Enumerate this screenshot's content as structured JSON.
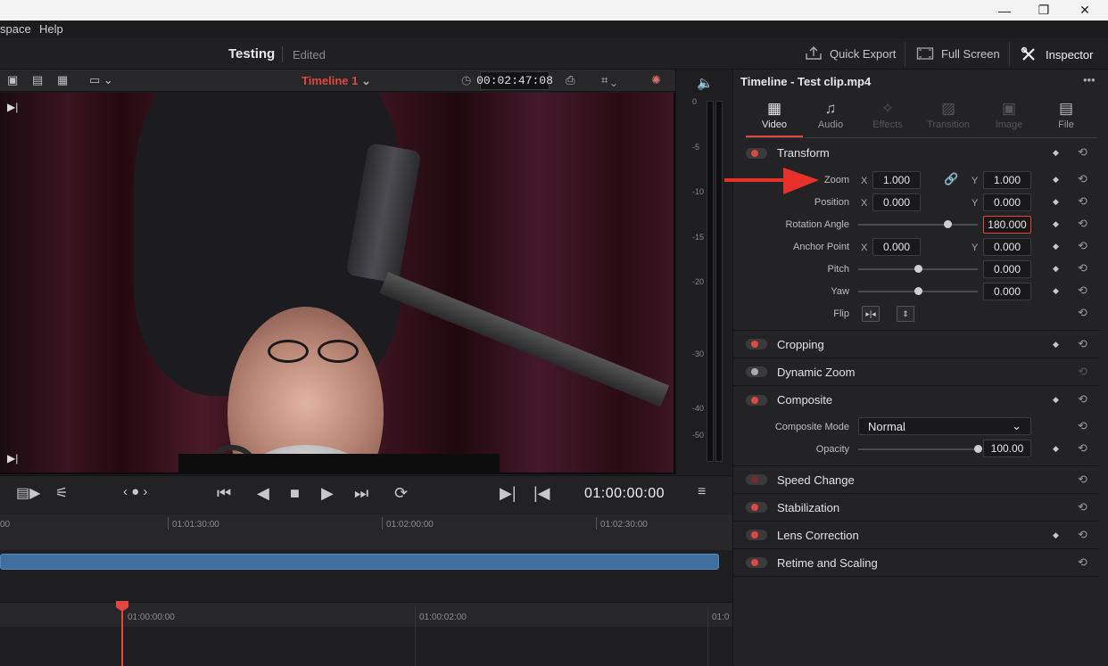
{
  "window": {
    "minimize": "—",
    "maximize": "❐",
    "close": "✕"
  },
  "menu": {
    "items": [
      "space",
      "Help"
    ]
  },
  "project": {
    "title": "Testing",
    "status": "Edited"
  },
  "header_buttons": {
    "quick_export": "Quick Export",
    "full_screen": "Full Screen",
    "inspector": "Inspector"
  },
  "viewer": {
    "timeline_name": "Timeline 1",
    "timecode": "00:02:47:08"
  },
  "meter": {
    "ticks": [
      "0",
      "-5",
      "-10",
      "-15",
      "-20",
      "-30",
      "-40",
      "-50"
    ]
  },
  "transport": {
    "timecode": "01:00:00:00"
  },
  "ruler": {
    "labels": [
      "00",
      "01:01:30:00",
      "01:02:00:00",
      "01:02:30:00"
    ]
  },
  "ruler2": {
    "labels": [
      "01:00:00:00",
      "01:00:02:00",
      "01:0"
    ]
  },
  "inspector": {
    "title": "Timeline - Test clip.mp4",
    "menu_icon": "•••",
    "tabs": [
      {
        "label": "Video",
        "icon": "film-icon",
        "glyph": "▦",
        "active": true
      },
      {
        "label": "Audio",
        "icon": "music-icon",
        "glyph": "♫",
        "active": false
      },
      {
        "label": "Effects",
        "icon": "magic-wand-icon",
        "glyph": "✧",
        "active": false
      },
      {
        "label": "Transition",
        "icon": "transition-icon",
        "glyph": "▨",
        "active": false
      },
      {
        "label": "Image",
        "icon": "image-icon",
        "glyph": "▣",
        "active": false
      },
      {
        "label": "File",
        "icon": "file-icon",
        "glyph": "▤",
        "active": false
      }
    ],
    "transform": {
      "header": "Transform",
      "zoom_label": "Zoom",
      "zoom_x": "1.000",
      "zoom_y": "1.000",
      "position_label": "Position",
      "position_x": "0.000",
      "position_y": "0.000",
      "rotation_label": "Rotation Angle",
      "rotation_value": "180.000",
      "rotation_level": 0.75,
      "anchor_label": "Anchor Point",
      "anchor_x": "0.000",
      "anchor_y": "0.000",
      "pitch_label": "Pitch",
      "pitch_value": "0.000",
      "pitch_level": 0.5,
      "yaw_label": "Yaw",
      "yaw_value": "0.000",
      "yaw_level": 0.5,
      "flip_label": "Flip",
      "x_axis": "X",
      "y_axis": "Y"
    },
    "sections": {
      "cropping": "Cropping",
      "dynamic_zoom": "Dynamic Zoom",
      "composite": "Composite",
      "composite_mode_label": "Composite Mode",
      "composite_mode_value": "Normal",
      "opacity_label": "Opacity",
      "opacity_value": "100.00",
      "opacity_level": 1.0,
      "speed_change": "Speed Change",
      "stabilization": "Stabilization",
      "lens_correction": "Lens Correction",
      "retime_scaling": "Retime and Scaling"
    }
  },
  "colors": {
    "accent": "#e0473f",
    "clip": "#3f6f9f",
    "annotation_arrow": "#e8302a"
  }
}
